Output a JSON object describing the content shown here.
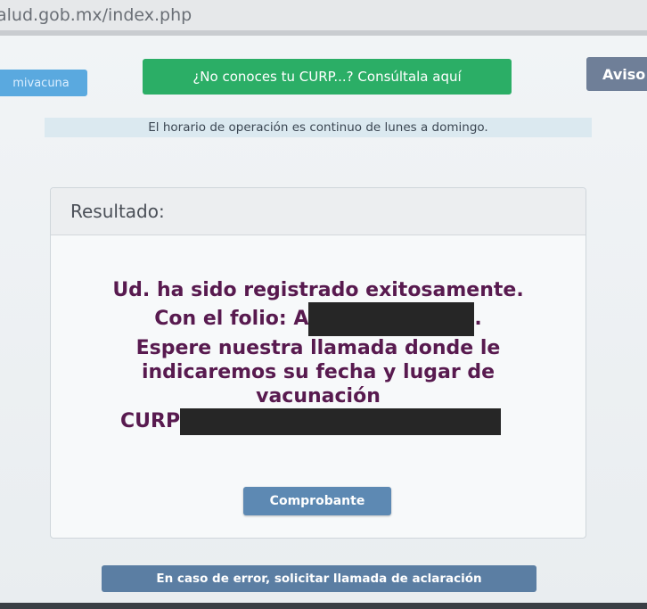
{
  "browser": {
    "url": "alud.gob.mx/index.php"
  },
  "nav": {
    "left_button": "mivacuna",
    "curp_button": "¿No conoces tu CURP...? Consúltala aquí",
    "aviso_button": "Aviso"
  },
  "notice": "El horario de operación es continuo de lunes a domingo.",
  "result": {
    "header": "Resultado:",
    "line1": "Ud. ha sido registrado exitosamente.",
    "folio_label": "Con el folio: A",
    "folio_suffix": ".",
    "line3": "Espere nuestra llamada donde le indicaremos su fecha y lugar de vacunación",
    "curp_label": "CURP",
    "comprobante_button": "Comprobante"
  },
  "error_button": "En caso de error, solicitar llamada de aclaración",
  "colors": {
    "green_button": "#2bae66",
    "blue_button": "#5aa9df",
    "slate_button": "#5b7ea3",
    "message_text": "#581a4f"
  }
}
